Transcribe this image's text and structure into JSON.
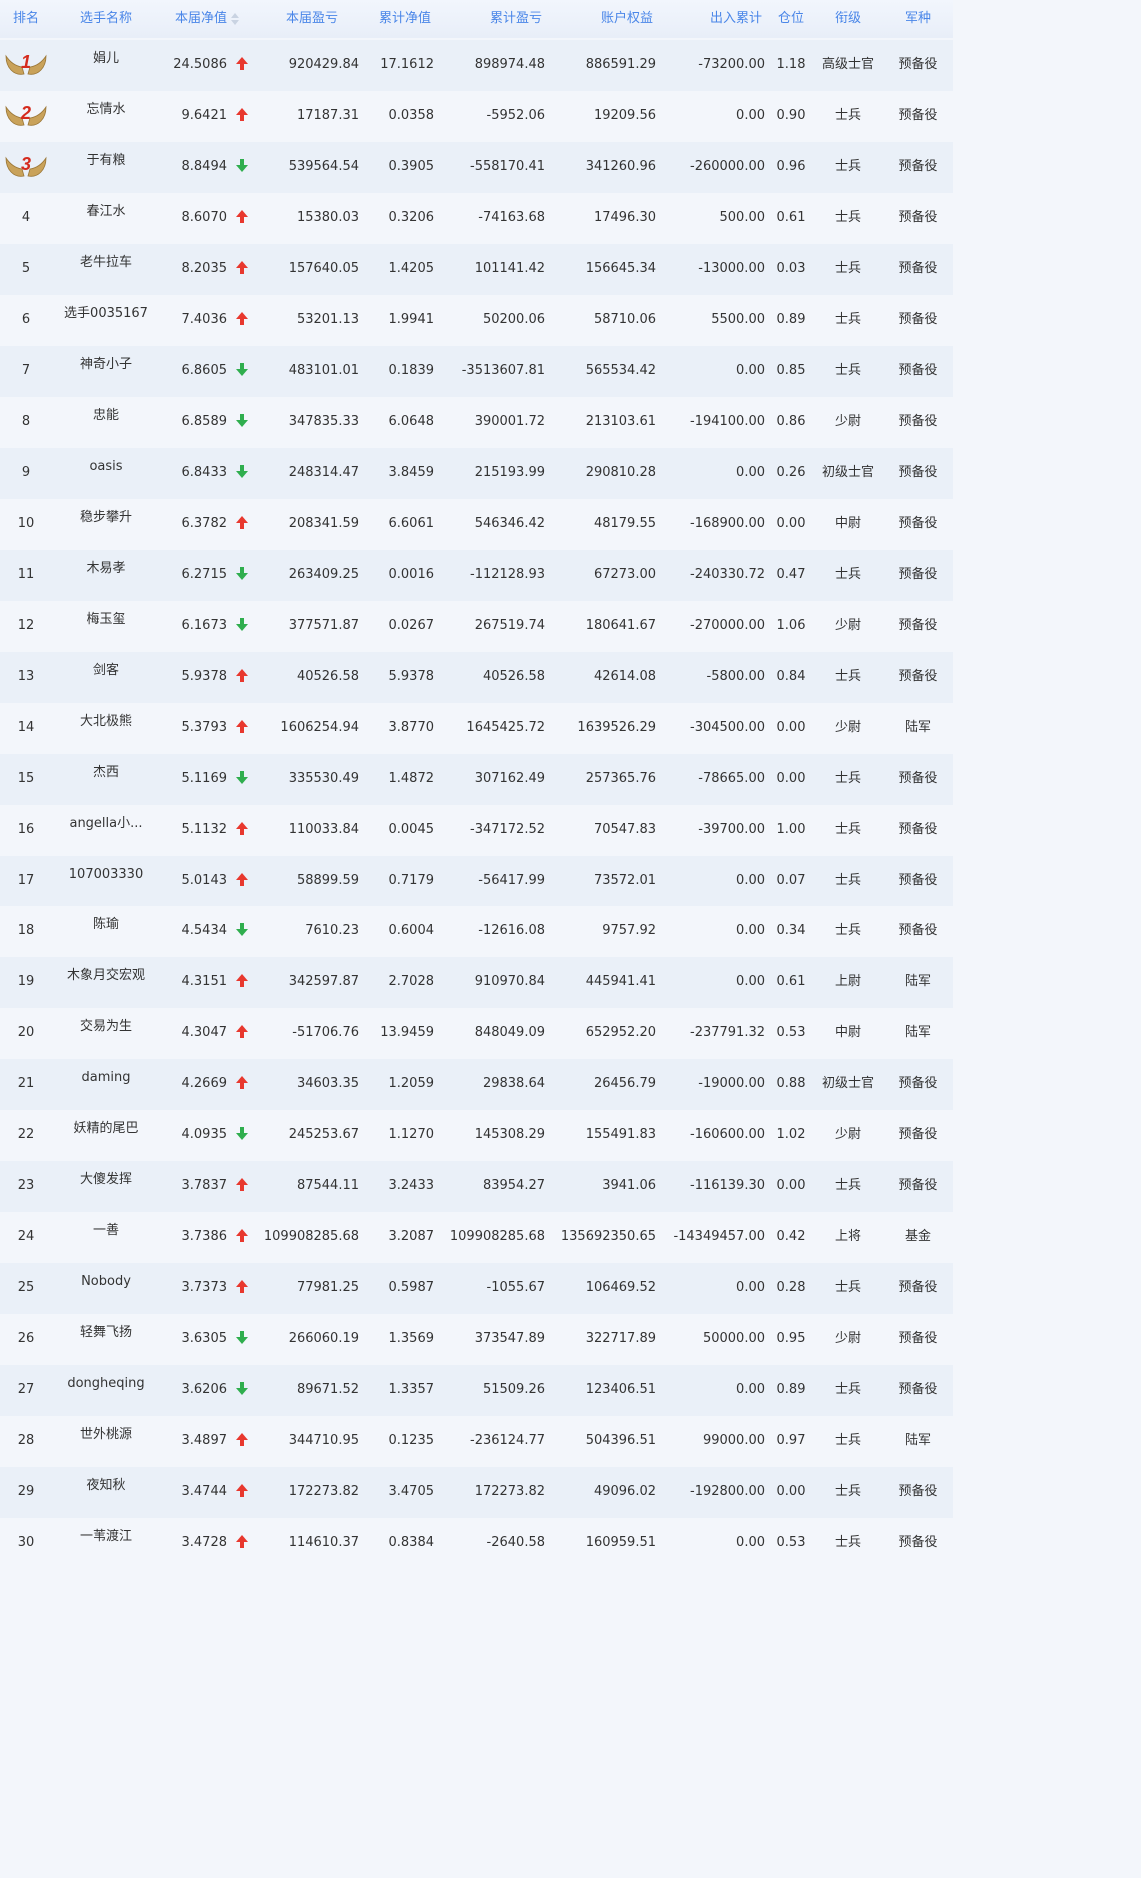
{
  "headers": [
    "排名",
    "选手名称",
    "本届净值",
    "本届盈亏",
    "累计净值",
    "累计盈亏",
    "账户权益",
    "出入累计",
    "仓位",
    "衔级",
    "军种"
  ],
  "colors": {
    "header_text": "#4a86e8",
    "up": "#e8382e",
    "down": "#2fae4e",
    "medal_red": "#d52b1e",
    "wing_gold": "#c9a25a"
  },
  "rows": [
    {
      "rank": "1",
      "name": "娟儿",
      "nav": "24.5086",
      "dir": "up",
      "pnl": "920429.84",
      "cum_nav": "17.1612",
      "cum_pnl": "898974.48",
      "equity": "886591.29",
      "flow": "-73200.00",
      "pos": "1.18",
      "grade": "高级士官",
      "branch": "预备役"
    },
    {
      "rank": "2",
      "name": "忘情水",
      "nav": "9.6421",
      "dir": "up",
      "pnl": "17187.31",
      "cum_nav": "0.0358",
      "cum_pnl": "-5952.06",
      "equity": "19209.56",
      "flow": "0.00",
      "pos": "0.90",
      "grade": "士兵",
      "branch": "预备役"
    },
    {
      "rank": "3",
      "name": "于有粮",
      "nav": "8.8494",
      "dir": "down",
      "pnl": "539564.54",
      "cum_nav": "0.3905",
      "cum_pnl": "-558170.41",
      "equity": "341260.96",
      "flow": "-260000.00",
      "pos": "0.96",
      "grade": "士兵",
      "branch": "预备役"
    },
    {
      "rank": "4",
      "name": "春江水",
      "nav": "8.6070",
      "dir": "up",
      "pnl": "15380.03",
      "cum_nav": "0.3206",
      "cum_pnl": "-74163.68",
      "equity": "17496.30",
      "flow": "500.00",
      "pos": "0.61",
      "grade": "士兵",
      "branch": "预备役"
    },
    {
      "rank": "5",
      "name": "老牛拉车",
      "nav": "8.2035",
      "dir": "up",
      "pnl": "157640.05",
      "cum_nav": "1.4205",
      "cum_pnl": "101141.42",
      "equity": "156645.34",
      "flow": "-13000.00",
      "pos": "0.03",
      "grade": "士兵",
      "branch": "预备役"
    },
    {
      "rank": "6",
      "name": "选手0035167",
      "nav": "7.4036",
      "dir": "up",
      "pnl": "53201.13",
      "cum_nav": "1.9941",
      "cum_pnl": "50200.06",
      "equity": "58710.06",
      "flow": "5500.00",
      "pos": "0.89",
      "grade": "士兵",
      "branch": "预备役"
    },
    {
      "rank": "7",
      "name": "神奇小子",
      "nav": "6.8605",
      "dir": "down",
      "pnl": "483101.01",
      "cum_nav": "0.1839",
      "cum_pnl": "-3513607.81",
      "equity": "565534.42",
      "flow": "0.00",
      "pos": "0.85",
      "grade": "士兵",
      "branch": "预备役"
    },
    {
      "rank": "8",
      "name": "忠能",
      "nav": "6.8589",
      "dir": "down",
      "pnl": "347835.33",
      "cum_nav": "6.0648",
      "cum_pnl": "390001.72",
      "equity": "213103.61",
      "flow": "-194100.00",
      "pos": "0.86",
      "grade": "少尉",
      "branch": "预备役"
    },
    {
      "rank": "9",
      "name": "oasis",
      "nav": "6.8433",
      "dir": "down",
      "pnl": "248314.47",
      "cum_nav": "3.8459",
      "cum_pnl": "215193.99",
      "equity": "290810.28",
      "flow": "0.00",
      "pos": "0.26",
      "grade": "初级士官",
      "branch": "预备役"
    },
    {
      "rank": "10",
      "name": "稳步攀升",
      "nav": "6.3782",
      "dir": "up",
      "pnl": "208341.59",
      "cum_nav": "6.6061",
      "cum_pnl": "546346.42",
      "equity": "48179.55",
      "flow": "-168900.00",
      "pos": "0.00",
      "grade": "中尉",
      "branch": "预备役"
    },
    {
      "rank": "11",
      "name": "木易孝",
      "nav": "6.2715",
      "dir": "down",
      "pnl": "263409.25",
      "cum_nav": "0.0016",
      "cum_pnl": "-112128.93",
      "equity": "67273.00",
      "flow": "-240330.72",
      "pos": "0.47",
      "grade": "士兵",
      "branch": "预备役"
    },
    {
      "rank": "12",
      "name": "梅玉玺",
      "nav": "6.1673",
      "dir": "down",
      "pnl": "377571.87",
      "cum_nav": "0.0267",
      "cum_pnl": "267519.74",
      "equity": "180641.67",
      "flow": "-270000.00",
      "pos": "1.06",
      "grade": "少尉",
      "branch": "预备役"
    },
    {
      "rank": "13",
      "name": "剑客",
      "nav": "5.9378",
      "dir": "up",
      "pnl": "40526.58",
      "cum_nav": "5.9378",
      "cum_pnl": "40526.58",
      "equity": "42614.08",
      "flow": "-5800.00",
      "pos": "0.84",
      "grade": "士兵",
      "branch": "预备役"
    },
    {
      "rank": "14",
      "name": "大北极熊",
      "nav": "5.3793",
      "dir": "up",
      "pnl": "1606254.94",
      "cum_nav": "3.8770",
      "cum_pnl": "1645425.72",
      "equity": "1639526.29",
      "flow": "-304500.00",
      "pos": "0.00",
      "grade": "少尉",
      "branch": "陆军"
    },
    {
      "rank": "15",
      "name": "杰西",
      "nav": "5.1169",
      "dir": "down",
      "pnl": "335530.49",
      "cum_nav": "1.4872",
      "cum_pnl": "307162.49",
      "equity": "257365.76",
      "flow": "-78665.00",
      "pos": "0.00",
      "grade": "士兵",
      "branch": "预备役"
    },
    {
      "rank": "16",
      "name": "angella小...",
      "nav": "5.1132",
      "dir": "up",
      "pnl": "110033.84",
      "cum_nav": "0.0045",
      "cum_pnl": "-347172.52",
      "equity": "70547.83",
      "flow": "-39700.00",
      "pos": "1.00",
      "grade": "士兵",
      "branch": "预备役"
    },
    {
      "rank": "17",
      "name": "107003330",
      "nav": "5.0143",
      "dir": "up",
      "pnl": "58899.59",
      "cum_nav": "0.7179",
      "cum_pnl": "-56417.99",
      "equity": "73572.01",
      "flow": "0.00",
      "pos": "0.07",
      "grade": "士兵",
      "branch": "预备役"
    },
    {
      "rank": "18",
      "name": "陈瑜",
      "nav": "4.5434",
      "dir": "down",
      "pnl": "7610.23",
      "cum_nav": "0.6004",
      "cum_pnl": "-12616.08",
      "equity": "9757.92",
      "flow": "0.00",
      "pos": "0.34",
      "grade": "士兵",
      "branch": "预备役"
    },
    {
      "rank": "19",
      "name": "木象月交宏观",
      "nav": "4.3151",
      "dir": "up",
      "pnl": "342597.87",
      "cum_nav": "2.7028",
      "cum_pnl": "910970.84",
      "equity": "445941.41",
      "flow": "0.00",
      "pos": "0.61",
      "grade": "上尉",
      "branch": "陆军"
    },
    {
      "rank": "20",
      "name": "交易为生",
      "nav": "4.3047",
      "dir": "up",
      "pnl": "-51706.76",
      "cum_nav": "13.9459",
      "cum_pnl": "848049.09",
      "equity": "652952.20",
      "flow": "-237791.32",
      "pos": "0.53",
      "grade": "中尉",
      "branch": "陆军"
    },
    {
      "rank": "21",
      "name": "daming",
      "nav": "4.2669",
      "dir": "up",
      "pnl": "34603.35",
      "cum_nav": "1.2059",
      "cum_pnl": "29838.64",
      "equity": "26456.79",
      "flow": "-19000.00",
      "pos": "0.88",
      "grade": "初级士官",
      "branch": "预备役"
    },
    {
      "rank": "22",
      "name": "妖精的尾巴",
      "nav": "4.0935",
      "dir": "down",
      "pnl": "245253.67",
      "cum_nav": "1.1270",
      "cum_pnl": "145308.29",
      "equity": "155491.83",
      "flow": "-160600.00",
      "pos": "1.02",
      "grade": "少尉",
      "branch": "预备役"
    },
    {
      "rank": "23",
      "name": "大傻发挥",
      "nav": "3.7837",
      "dir": "up",
      "pnl": "87544.11",
      "cum_nav": "3.2433",
      "cum_pnl": "83954.27",
      "equity": "3941.06",
      "flow": "-116139.30",
      "pos": "0.00",
      "grade": "士兵",
      "branch": "预备役"
    },
    {
      "rank": "24",
      "name": "一善",
      "nav": "3.7386",
      "dir": "up",
      "pnl": "109908285.68",
      "cum_nav": "3.2087",
      "cum_pnl": "109908285.68",
      "equity": "135692350.65",
      "flow": "-14349457.00",
      "pos": "0.42",
      "grade": "上将",
      "branch": "基金"
    },
    {
      "rank": "25",
      "name": "Nobody",
      "nav": "3.7373",
      "dir": "up",
      "pnl": "77981.25",
      "cum_nav": "0.5987",
      "cum_pnl": "-1055.67",
      "equity": "106469.52",
      "flow": "0.00",
      "pos": "0.28",
      "grade": "士兵",
      "branch": "预备役"
    },
    {
      "rank": "26",
      "name": "轻舞飞扬",
      "nav": "3.6305",
      "dir": "down",
      "pnl": "266060.19",
      "cum_nav": "1.3569",
      "cum_pnl": "373547.89",
      "equity": "322717.89",
      "flow": "50000.00",
      "pos": "0.95",
      "grade": "少尉",
      "branch": "预备役"
    },
    {
      "rank": "27",
      "name": "dongheqing",
      "nav": "3.6206",
      "dir": "down",
      "pnl": "89671.52",
      "cum_nav": "1.3357",
      "cum_pnl": "51509.26",
      "equity": "123406.51",
      "flow": "0.00",
      "pos": "0.89",
      "grade": "士兵",
      "branch": "预备役"
    },
    {
      "rank": "28",
      "name": "世外桃源",
      "nav": "3.4897",
      "dir": "up",
      "pnl": "344710.95",
      "cum_nav": "0.1235",
      "cum_pnl": "-236124.77",
      "equity": "504396.51",
      "flow": "99000.00",
      "pos": "0.97",
      "grade": "士兵",
      "branch": "陆军"
    },
    {
      "rank": "29",
      "name": "夜知秋",
      "nav": "3.4744",
      "dir": "up",
      "pnl": "172273.82",
      "cum_nav": "3.4705",
      "cum_pnl": "172273.82",
      "equity": "49096.02",
      "flow": "-192800.00",
      "pos": "0.00",
      "grade": "士兵",
      "branch": "预备役"
    },
    {
      "rank": "30",
      "name": "一苇渡江",
      "nav": "3.4728",
      "dir": "up",
      "pnl": "114610.37",
      "cum_nav": "0.8384",
      "cum_pnl": "-2640.58",
      "equity": "160959.51",
      "flow": "0.00",
      "pos": "0.53",
      "grade": "士兵",
      "branch": "预备役"
    }
  ]
}
